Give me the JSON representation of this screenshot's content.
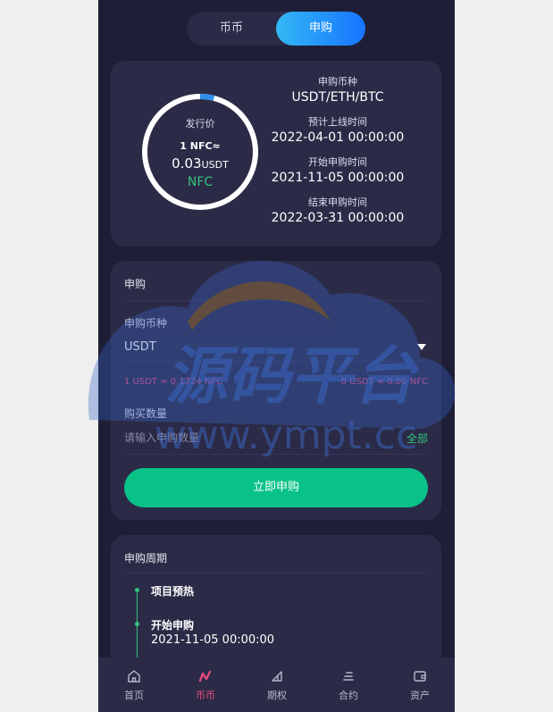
{
  "tabs": {
    "coin": "币币",
    "subscribe": "申购"
  },
  "issue": {
    "label": "发行价",
    "rate": "1 NFC≈",
    "price": "0.03",
    "price_unit": "USDT",
    "token": "NFC",
    "progress": 0.04
  },
  "info": [
    {
      "label": "申购币种",
      "value": "USDT/ETH/BTC"
    },
    {
      "label": "预计上线时间",
      "value": "2022-04-01 00:00:00"
    },
    {
      "label": "开始申购时间",
      "value": "2021-11-05 00:00:00"
    },
    {
      "label": "结束申购时间",
      "value": "2022-03-31 00:00:00"
    }
  ],
  "form": {
    "title": "申购",
    "currency_label": "申购币种",
    "currency_value": "USDT",
    "rate_left": "1 USDT ≈ 0.1724 NFC",
    "rate_right": "0 USDT ≈ 0.00 NFC",
    "quantity_label": "购买数量",
    "quantity_placeholder": "请输入申购数量",
    "all_label": "全部",
    "submit_label": "立即申购"
  },
  "cycle": {
    "title": "申购周期",
    "steps": [
      {
        "title": "项目预热",
        "time": ""
      },
      {
        "title": "开始申购",
        "time": "2021-11-05 00:00:00"
      }
    ]
  },
  "watermark": {
    "brand": "源码平台",
    "url": "www.ympt.cc"
  },
  "nav": [
    {
      "label": "首页",
      "icon": "home-icon"
    },
    {
      "label": "币币",
      "icon": "coin-trade-icon"
    },
    {
      "label": "期权",
      "icon": "options-icon"
    },
    {
      "label": "合约",
      "icon": "contract-icon"
    },
    {
      "label": "资产",
      "icon": "wallet-icon"
    }
  ],
  "colors": {
    "accent_green": "#35c27d",
    "accent_pink": "#e84a7e",
    "button_green": "#08c287",
    "tab_gradient_start": "#34b8f5",
    "tab_gradient_end": "#1674ff",
    "background": "#1e1e36",
    "card": "#2b2b47"
  }
}
